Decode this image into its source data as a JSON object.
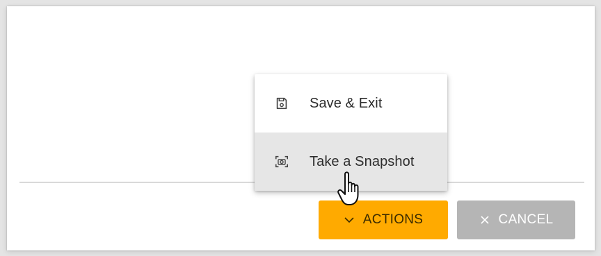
{
  "menu": {
    "items": [
      {
        "label": "Save & Exit",
        "icon": "save-icon"
      },
      {
        "label": "Take a Snapshot",
        "icon": "camera-icon"
      }
    ]
  },
  "footer": {
    "actions_label": "ACTIONS",
    "actions_icon": "chevron-down-icon",
    "cancel_label": "CANCEL",
    "cancel_icon": "close-icon"
  },
  "colors": {
    "accent": "#ffaa00",
    "cancel_bg": "#b5b5b5",
    "menu_hover": "#e6e6e6"
  }
}
